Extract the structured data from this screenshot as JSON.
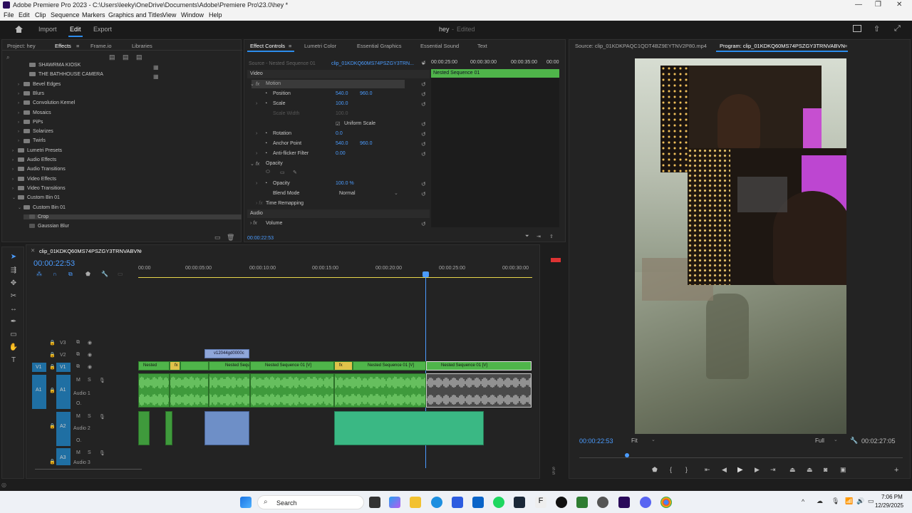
{
  "window": {
    "title": "Adobe Premiere Pro 2023 - C:\\Users\\leeky\\OneDrive\\Documents\\Adobe\\Premiere Pro\\23.0\\hey *"
  },
  "menu": [
    "File",
    "Edit",
    "Clip",
    "Sequence",
    "Markers",
    "Graphics and Titles",
    "View",
    "Window",
    "Help"
  ],
  "header": {
    "workspaces": [
      "Import",
      "Edit",
      "Export"
    ],
    "active_workspace": "Edit",
    "project_name": "hey",
    "status": "Edited"
  },
  "project_panel": {
    "tabs": [
      "Project: hey",
      "Effects",
      "Frame.io",
      "Libraries"
    ],
    "active_tab": "Effects",
    "tree": [
      {
        "label": "SHAWRMA KIOSK",
        "indent": 3,
        "type": "item"
      },
      {
        "label": "THE BATHHOUSE CAMERA",
        "indent": 3,
        "type": "item"
      },
      {
        "label": "Bevel Edges",
        "indent": 2,
        "type": "folder"
      },
      {
        "label": "Blurs",
        "indent": 2,
        "type": "folder"
      },
      {
        "label": "Convolution Kernel",
        "indent": 2,
        "type": "folder"
      },
      {
        "label": "Mosaics",
        "indent": 2,
        "type": "folder"
      },
      {
        "label": "PiPs",
        "indent": 2,
        "type": "folder"
      },
      {
        "label": "Solarizes",
        "indent": 2,
        "type": "folder"
      },
      {
        "label": "Twirls",
        "indent": 2,
        "type": "folder"
      },
      {
        "label": "Lumetri Presets",
        "indent": 1,
        "type": "folder"
      },
      {
        "label": "Audio Effects",
        "indent": 1,
        "type": "folder"
      },
      {
        "label": "Audio Transitions",
        "indent": 1,
        "type": "folder"
      },
      {
        "label": "Video Effects",
        "indent": 1,
        "type": "folder"
      },
      {
        "label": "Video Transitions",
        "indent": 1,
        "type": "folder"
      },
      {
        "label": "Custom Bin 01",
        "indent": 1,
        "type": "folder"
      },
      {
        "label": "Custom Bin 01",
        "indent": 2,
        "type": "folder"
      },
      {
        "label": "Crop",
        "indent": 3,
        "type": "effect"
      },
      {
        "label": "Gaussian Blur",
        "indent": 3,
        "type": "effect"
      }
    ]
  },
  "effect_controls": {
    "tabs": [
      "Effect Controls",
      "Lumetri Color",
      "Essential Graphics",
      "Essential Sound",
      "Text"
    ],
    "source": "Source - Nested Sequence 01",
    "clip": "clip_01KDKQ60MS74PSZGY3TRN...",
    "timecodes": [
      "00:00:25:00",
      "00:00:30:00",
      "00:00:35:00",
      "00:00"
    ],
    "nested_label": "Nested Sequence 01",
    "sections": {
      "video": "Video",
      "motion": "Motion",
      "position_label": "Position",
      "position_x": "540.0",
      "position_y": "960.0",
      "scale_label": "Scale",
      "scale_value": "100.0",
      "scale_width_label": "Scale Width",
      "scale_width_value": "100.0",
      "uniform_scale": "Uniform Scale",
      "rotation_label": "Rotation",
      "rotation_value": "0.0",
      "anchor_label": "Anchor Point",
      "anchor_x": "540.0",
      "anchor_y": "960.0",
      "antiflicker_label": "Anti-flicker Filter",
      "antiflicker_value": "0.00",
      "opacity_section": "Opacity",
      "opacity_label": "Opacity",
      "opacity_value": "100.0 %",
      "blend_label": "Blend Mode",
      "blend_value": "Normal",
      "time_remap": "Time Remapping",
      "audio": "Audio",
      "volume": "Volume"
    },
    "footer_time": "00:00:22:53"
  },
  "source_monitor": {
    "source_tab": "Source: clip_01KDKPAQC1QDT4BZ9EYTNV2P80.mp4",
    "program_tab": "Program: clip_01KDKQ60MS74PSZGY3TRNVABVN",
    "timecode_left": "00:00:22:53",
    "fit": "Fit",
    "quality": "Full",
    "timecode_right": "00:02:27:05"
  },
  "timeline": {
    "sequence_name": "clip_01KDKQ60MS74PSZGY3TRNVABVN",
    "timecode": "00:00:22:53",
    "ruler": [
      "00:00",
      "00:00:05:00",
      "00:00:10:00",
      "00:00:15:00",
      "00:00:20:00",
      "00:00:25:00",
      "00:00:30:00"
    ],
    "tracks": {
      "v3": "V3",
      "v2": "V2",
      "v1": "V1",
      "v1_src": "V1",
      "a1": "A1",
      "a1_src": "A1",
      "a1_name": "Audio 1",
      "a2": "A2",
      "a2_name": "Audio 2",
      "a3": "A3",
      "a3_name": "Audio 3"
    },
    "clips": {
      "v2_clip": "v12044gd0000c",
      "v1_nested": "Nested",
      "v1_nested_seq": "Nested Sequ",
      "v1_nested_seq01": "Nested Sequence 01 [V]",
      "v1_nested_seq01b": "Nested Sequence 01 [V]",
      "v1_nested_seq01c": "Nested Sequence 01 [V]",
      "fx": "fx"
    },
    "meter_label": "S S"
  },
  "taskbar": {
    "search": "Search",
    "time": "7:06 PM",
    "date": "12/29/2025"
  },
  "colors": {
    "accent": "#2d8ceb",
    "clip_green": "#4fb54a",
    "audio_green": "#3f9a3c",
    "track_blue": "#1f6fa3"
  }
}
